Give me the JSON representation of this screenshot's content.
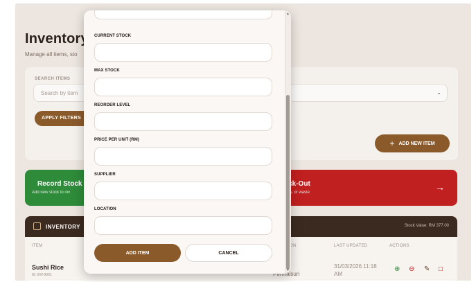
{
  "page": {
    "title": "Inventory",
    "subtitle": "Manage all items, sto"
  },
  "filters": {
    "search_label": "SEARCH ITEMS",
    "search_placeholder": "Search by item",
    "apply_label": "APPLY FILTERS",
    "add_new_label": "ADD NEW ITEM"
  },
  "actions": {
    "stock_in_title": "Record Stock",
    "stock_in_sub": "Add new stock to inv",
    "stock_out_title": "ock-Out",
    "stock_out_sub": "ales, or waste"
  },
  "inventory": {
    "header_title": "INVENTORY",
    "stock_value": "Stock Value: RM 377.00",
    "columns": [
      "ITEM",
      "TION",
      "LAST UPDATED",
      "ACTIONS"
    ],
    "rows": [
      {
        "name": "Sushi Rice",
        "id": "ID: INV-0001",
        "supplier": "der Sri Permaisuri",
        "updated": "31/03/2026 11:18 AM"
      }
    ]
  },
  "modal": {
    "fields": [
      {
        "label": "CURRENT STOCK",
        "value": ""
      },
      {
        "label": "MAX STOCK",
        "value": ""
      },
      {
        "label": "REORDER LEVEL",
        "value": ""
      },
      {
        "label": "PRICE PER UNIT (RM)",
        "value": ""
      },
      {
        "label": "SUPPLIER",
        "value": ""
      },
      {
        "label": "LOCATION",
        "value": ""
      }
    ],
    "add_label": "ADD ITEM",
    "cancel_label": "CANCEL"
  },
  "colors": {
    "brand": "#8b5a2b",
    "stock_in": "#2e8b3a",
    "stock_out": "#c0201f",
    "header_dark": "#3b2a20"
  }
}
